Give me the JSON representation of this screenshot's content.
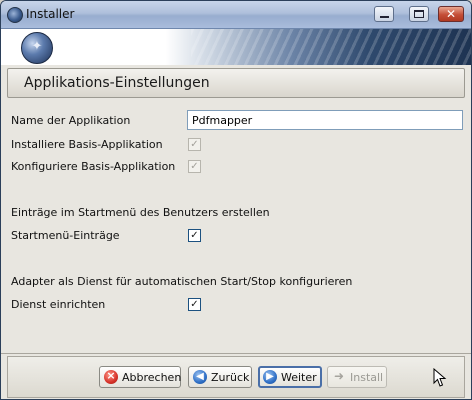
{
  "window": {
    "title": "Installer",
    "controls": {
      "minimize": "minimize",
      "maximize": "maximize",
      "close": "✕"
    }
  },
  "header": {
    "title": "Applikations-Einstellungen"
  },
  "form": {
    "app_name_label": "Name der Applikation",
    "app_name_value": "Pdfmapper",
    "install_base_label": "Installiere Basis-Applikation",
    "install_base_checked": true,
    "install_base_enabled": false,
    "configure_base_label": "Konfiguriere Basis-Applikation",
    "configure_base_checked": true,
    "configure_base_enabled": false,
    "startmenu_section": "Einträge im Startmenü des Benutzers erstellen",
    "startmenu_label": "Startmenü-Einträge",
    "startmenu_checked": true,
    "service_section": "Adapter als Dienst für automatischen Start/Stop konfigurieren",
    "service_label": "Dienst einrichten",
    "service_checked": true
  },
  "buttons": {
    "cancel": "Abbrechen",
    "back": "Zurück",
    "next": "Weiter",
    "install": "Install",
    "install_enabled": false
  },
  "icons": {
    "title": "app-logo-icon",
    "cancel": "cancel-icon",
    "back": "arrow-left-icon",
    "next": "arrow-right-icon",
    "install": "install-icon"
  },
  "colors": {
    "titlebar": "#aebfdb",
    "window_bg": "#e8e6e0",
    "input_border": "#7f9db9",
    "default_button_border": "#4a6fa8"
  }
}
